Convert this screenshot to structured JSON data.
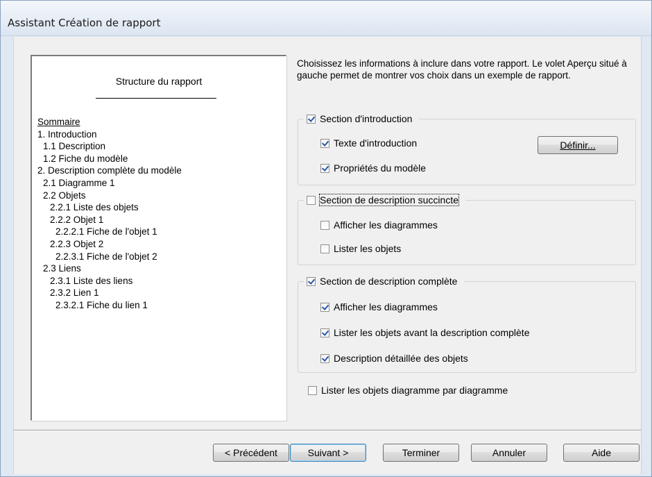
{
  "window": {
    "title": "Assistant Création de rapport"
  },
  "preview": {
    "title": "Structure du rapport",
    "toc": [
      {
        "text": "Sommaire",
        "level": 1,
        "underline": true
      },
      {
        "text": "1. Introduction",
        "level": 1
      },
      {
        "text": "1.1 Description",
        "level": 2
      },
      {
        "text": "1.2 Fiche du modèle",
        "level": 2
      },
      {
        "text": "2. Description complète du modèle",
        "level": 1
      },
      {
        "text": "2.1 Diagramme 1",
        "level": 2
      },
      {
        "text": "2.2 Objets",
        "level": 2
      },
      {
        "text": "2.2.1 Liste des objets",
        "level": 3
      },
      {
        "text": "2.2.2 Objet 1",
        "level": 3
      },
      {
        "text": "2.2.2.1 Fiche de l'objet 1",
        "level": 4
      },
      {
        "text": "2.2.3 Objet 2",
        "level": 3
      },
      {
        "text": "2.2.3.1 Fiche de l'objet 2",
        "level": 4
      },
      {
        "text": "2.3 Liens",
        "level": 2
      },
      {
        "text": "2.3.1 Liste des liens",
        "level": 3
      },
      {
        "text": "2.3.2 Lien 1",
        "level": 3
      },
      {
        "text": "2.3.2.1 Fiche du lien 1",
        "level": 4
      }
    ]
  },
  "instructions": "Choisissez les informations à inclure dans votre rapport. Le volet Aperçu situé à gauche permet de montrer vos choix dans un exemple de rapport.",
  "sections": {
    "intro": {
      "label": "Section d'introduction",
      "checked": true,
      "options": [
        {
          "label": "Texte d'introduction",
          "checked": true
        },
        {
          "label": "Propriétés du modèle",
          "checked": true
        }
      ],
      "define_button": "Définir..."
    },
    "summary": {
      "label": "Section de description succincte",
      "checked": false,
      "options": [
        {
          "label": "Afficher les diagrammes",
          "checked": false
        },
        {
          "label": "Lister les objets",
          "checked": false
        }
      ]
    },
    "full": {
      "label": "Section de description complète",
      "checked": true,
      "options": [
        {
          "label": "Afficher les diagrammes",
          "checked": true
        },
        {
          "label": "Lister les objets avant la description complète",
          "checked": true
        },
        {
          "label": "Description détaillée des objets",
          "checked": true
        }
      ]
    },
    "list_by_diagram": {
      "label": "Lister les objets diagramme par diagramme",
      "checked": false
    }
  },
  "buttons": {
    "previous": "< Précédent",
    "next": "Suivant >",
    "finish": "Terminer",
    "cancel": "Annuler",
    "help": "Aide"
  }
}
